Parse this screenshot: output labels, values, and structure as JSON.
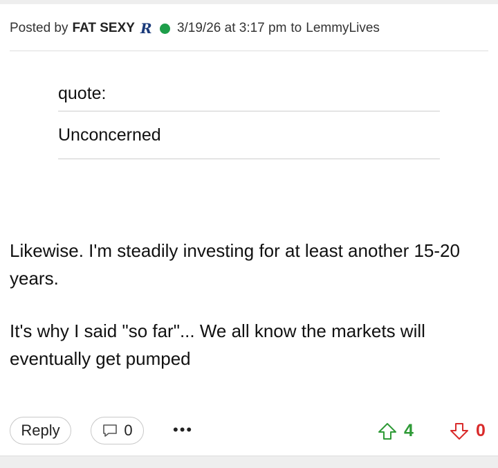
{
  "post": {
    "posted_by_label": "Posted by",
    "author": "FAT SEXY",
    "team_logo_icon": "rice-owls-r-logo",
    "online_status_color": "#1e9e4a",
    "timestamp": "3/19/26 at 3:17 pm",
    "to_label": "to",
    "recipient": "LemmyLives"
  },
  "quote": {
    "label": "quote:",
    "text": "Unconcerned"
  },
  "body": {
    "paragraphs": [
      "Likewise. I'm steadily investing for at least another 15-20 years.",
      "It's why I said \"so far\"... We all know the markets will eventually get pumped"
    ]
  },
  "actions": {
    "reply_label": "Reply",
    "comment_icon": "speech-bubble-icon",
    "comment_count": "0",
    "more_label": "•••",
    "upvote_icon": "up-arrow-icon",
    "upvote_count": "4",
    "upvote_color": "#2e9a36",
    "downvote_icon": "down-arrow-icon",
    "downvote_count": "0",
    "downvote_color": "#d92b2b"
  }
}
